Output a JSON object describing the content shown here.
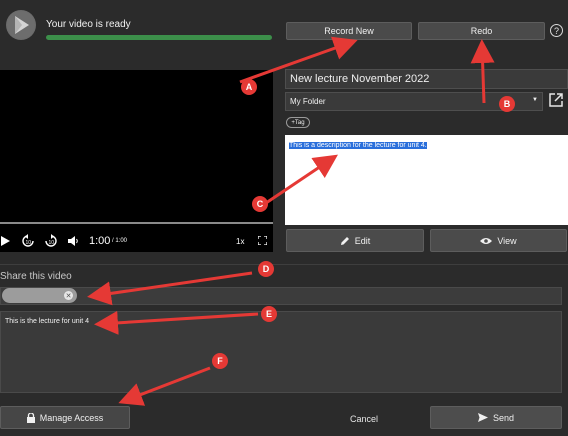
{
  "header": {
    "status": "Your video is ready",
    "progress_percent": 100
  },
  "toolbar": {
    "record_new": "Record New",
    "redo": "Redo",
    "help_icon": "?"
  },
  "player": {
    "time": "1:00",
    "duration": "/ 1:00",
    "speed": "1x"
  },
  "details": {
    "title": "New lecture November 2022",
    "folder": "My Folder",
    "tag_label": "+Tag",
    "description": "This is a description for the lecture for unit 4."
  },
  "actions": {
    "edit": "Edit",
    "view": "View"
  },
  "share": {
    "label": "Share this video",
    "message": "This is the lecture for unit 4",
    "chip_remove": "✕"
  },
  "footer": {
    "manage_access": "Manage Access",
    "cancel": "Cancel",
    "send": "Send"
  },
  "annotations": [
    "A",
    "B",
    "C",
    "D",
    "E",
    "F"
  ],
  "colors": {
    "annotation": "#e53935",
    "progress": "#3c8f4a",
    "selection": "#2a6fdb"
  }
}
